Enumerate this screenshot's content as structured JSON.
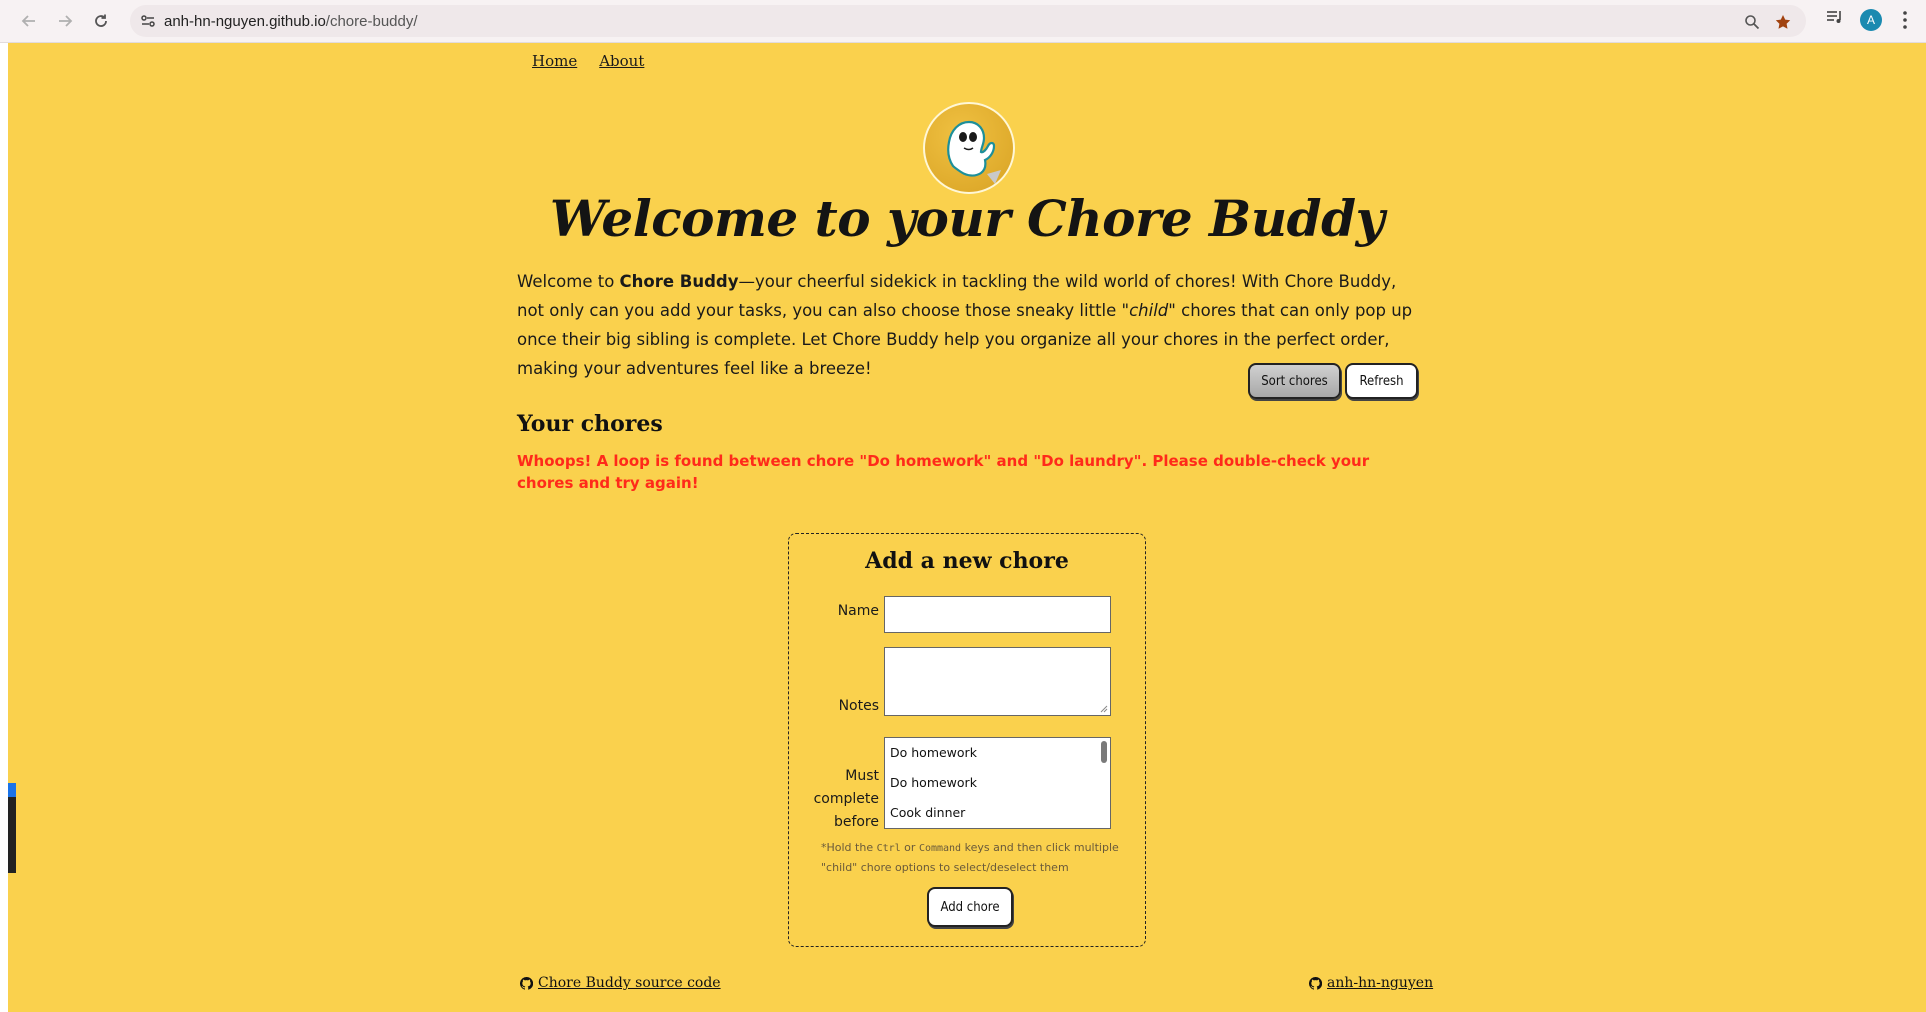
{
  "browser": {
    "url_domain": "anh-hn-nguyen.github.io",
    "url_path": "/chore-buddy/",
    "avatar_letter": "A"
  },
  "nav": {
    "home": "Home",
    "about": "About"
  },
  "header": {
    "title": "Welcome to your Chore Buddy"
  },
  "intro": {
    "p1": "Welcome to ",
    "brand": "Chore Buddy",
    "p2": "—your cheerful sidekick in tackling the wild world of chores! With Chore Buddy, not only can you add your tasks, you can also choose those sneaky little ",
    "child": "\"child\"",
    "p3": " chores that can only pop up once their big sibling is complete. Let Chore Buddy help you organize all your chores in the perfect order, making your adventures feel like a breeze!"
  },
  "actions": {
    "sort": "Sort chores",
    "refresh": "Refresh"
  },
  "chores": {
    "title": "Your chores",
    "error": "Whoops! A loop is found between chore \"Do homework\" and \"Do laundry\". Please double-check your chores and try again!"
  },
  "form": {
    "title": "Add a new chore",
    "name_label": "Name",
    "notes_label": "Notes",
    "before_label_1": "Must",
    "before_label_2": "complete",
    "before_label_3": "before",
    "options": [
      "Do homework",
      "Do homework",
      "Cook dinner"
    ],
    "hint_1": "*Hold the ",
    "hint_ctrl": "Ctrl",
    "hint_2": " or ",
    "hint_cmd": "Command",
    "hint_3": " keys and then click multiple \"child\" chore options to select/deselect them",
    "submit": "Add chore"
  },
  "footer": {
    "source": "Chore Buddy source code",
    "author": "anh-hn-nguyen"
  },
  "colors": {
    "background": "#fad14d",
    "error": "#ff2a1a"
  },
  "icons": [
    "back-arrow-icon",
    "forward-arrow-icon",
    "reload-icon",
    "site-settings-icon",
    "zoom-icon",
    "bookmark-star-icon",
    "media-icon",
    "github-icon"
  ]
}
